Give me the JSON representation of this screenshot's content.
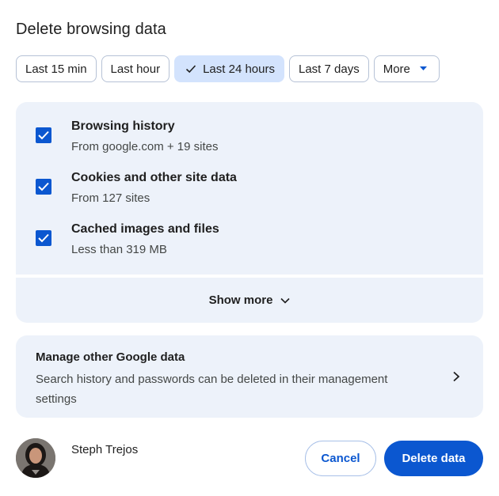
{
  "dialog": {
    "title": "Delete browsing data"
  },
  "time_ranges": {
    "options": [
      "Last 15 min",
      "Last hour",
      "Last 24 hours",
      "Last 7 days"
    ],
    "selected": "Last 24 hours",
    "more_label": "More"
  },
  "data_types": [
    {
      "label": "Browsing history",
      "detail": "From google.com + 19 sites",
      "checked": true
    },
    {
      "label": "Cookies and other site data",
      "detail": "From 127 sites",
      "checked": true
    },
    {
      "label": "Cached images and files",
      "detail": "Less than 319 MB",
      "checked": true
    }
  ],
  "show_more": {
    "label": "Show more"
  },
  "manage_other": {
    "title": "Manage other Google data",
    "description": "Search history and passwords can be deleted in their management settings"
  },
  "account": {
    "name": "Steph Trejos"
  },
  "actions": {
    "cancel_label": "Cancel",
    "delete_label": "Delete data"
  },
  "colors": {
    "accent": "#0b57d0",
    "panel_bg": "#edf2fa",
    "chip_selected_bg": "#d3e3fd"
  },
  "icons": {
    "selected_chip": "check-icon",
    "more_chip": "caret-down-icon",
    "checkbox": "checkmark-icon",
    "show_more": "chevron-down-icon",
    "manage_other": "chevron-right-icon"
  }
}
